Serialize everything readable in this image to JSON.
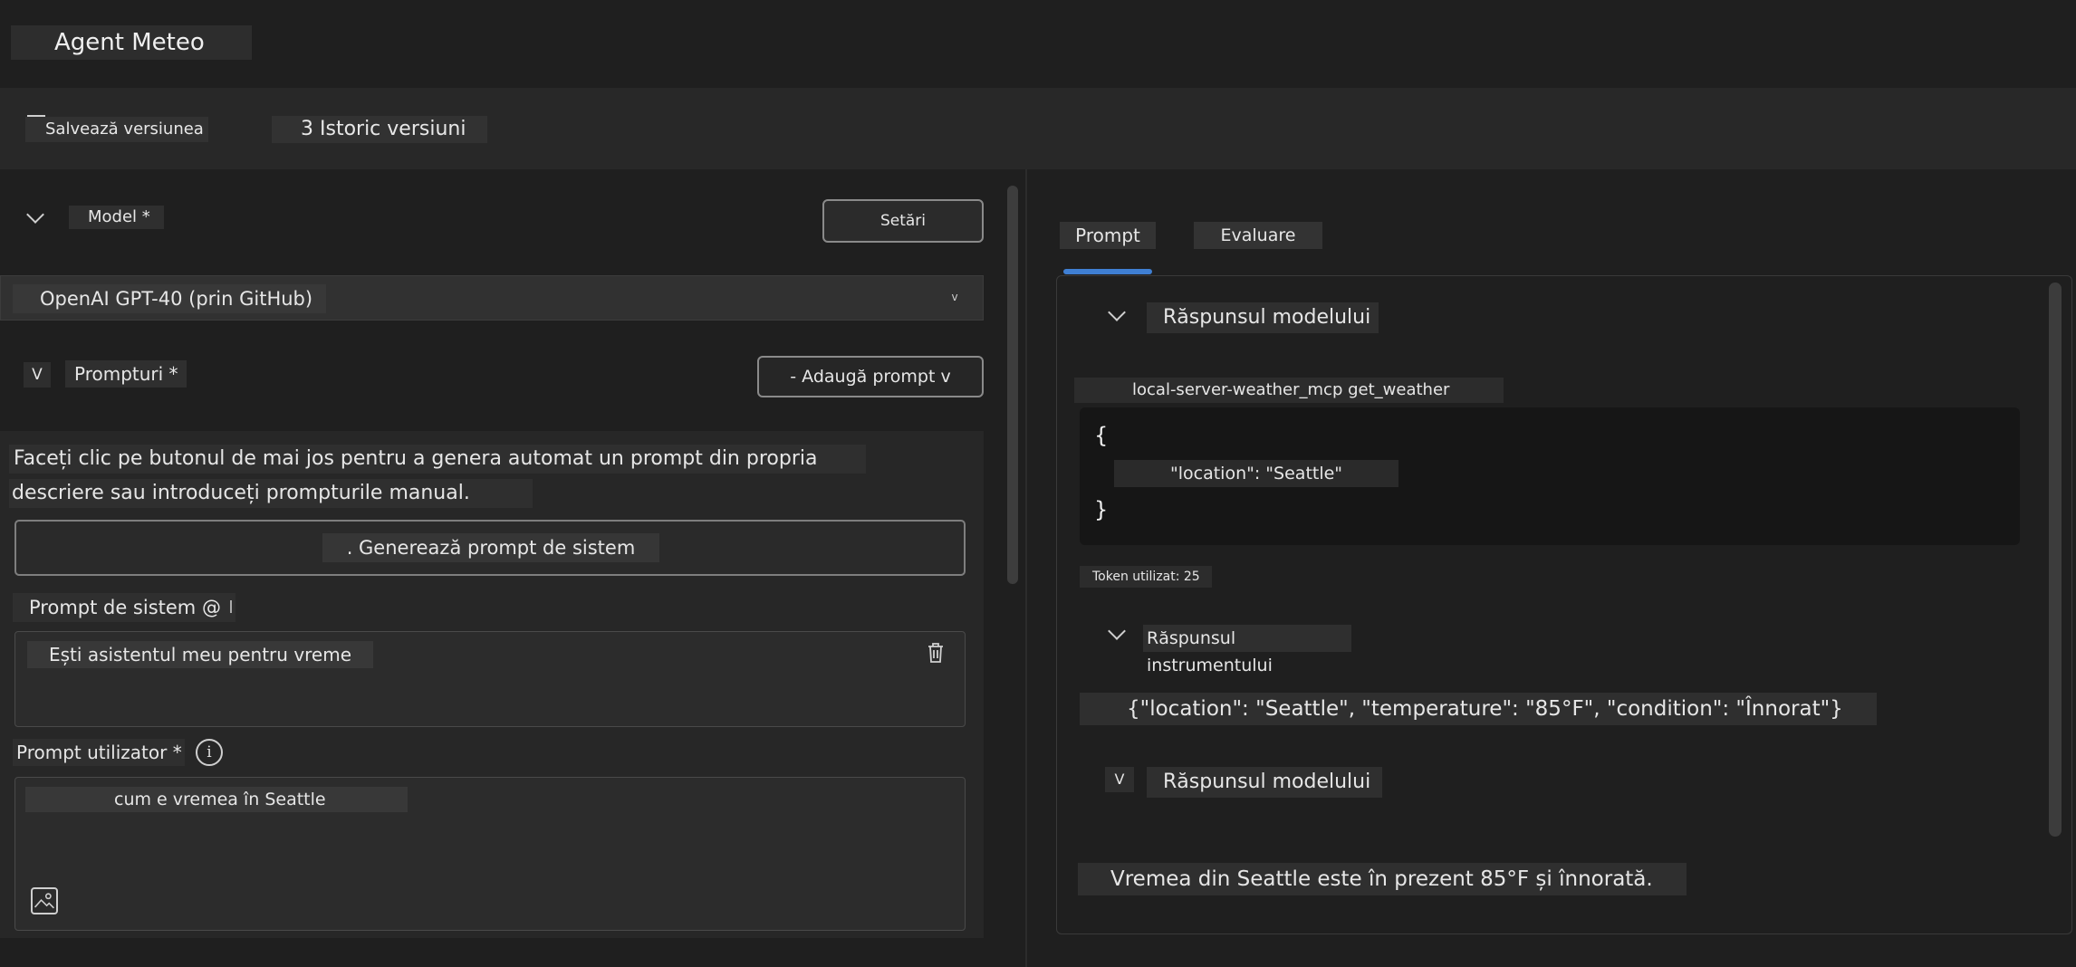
{
  "header": {
    "title": "Agent Meteo"
  },
  "toolbar": {
    "save_label": "Salvează versiunea",
    "history_label": "3 Istoric versiuni"
  },
  "model": {
    "label": "Model *",
    "settings_label": "Setări",
    "selected": "OpenAI GPT-40 (prin GitHub)",
    "caret": "v"
  },
  "prompts": {
    "toggle": "V",
    "label": "Prompturi *",
    "add_label": "- Adaugă prompt v",
    "description_line1": "Faceți clic pe butonul de mai jos pentru a genera automat un prompt din propria",
    "description_line2": "descriere sau introduceți prompturile manual.",
    "generate_label": ". Generează prompt de sistem",
    "system": {
      "label": "Prompt de sistem @",
      "value": "Ești asistentul meu pentru vreme"
    },
    "user": {
      "label": "Prompt utilizator *",
      "value": "cum e vremea în Seattle"
    }
  },
  "tabs": [
    {
      "label": "Prompt"
    },
    {
      "label": "Evaluare"
    }
  ],
  "response": {
    "model_response_label": "Răspunsul modelului",
    "tool_call": "local-server-weather_mcp get_weather",
    "code_open": "{",
    "code_kv": "\"location\": \"Seattle\"",
    "code_close": "}",
    "tokens": "Token utilizat: 25",
    "tool_response_label": "Răspunsul instrumentului",
    "tool_json": "{\"location\": \"Seattle\", \"temperature\": \"85°F\", \"condition\": \"Înnorat\"}",
    "model_response2_toggle": "V",
    "model_response2_label": "Răspunsul modelului",
    "final_answer": "Vremea din Seattle este în prezent 85°F și înnorată."
  },
  "colors": {
    "accent": "#3f7fd3",
    "background": "#1f1f1f"
  }
}
